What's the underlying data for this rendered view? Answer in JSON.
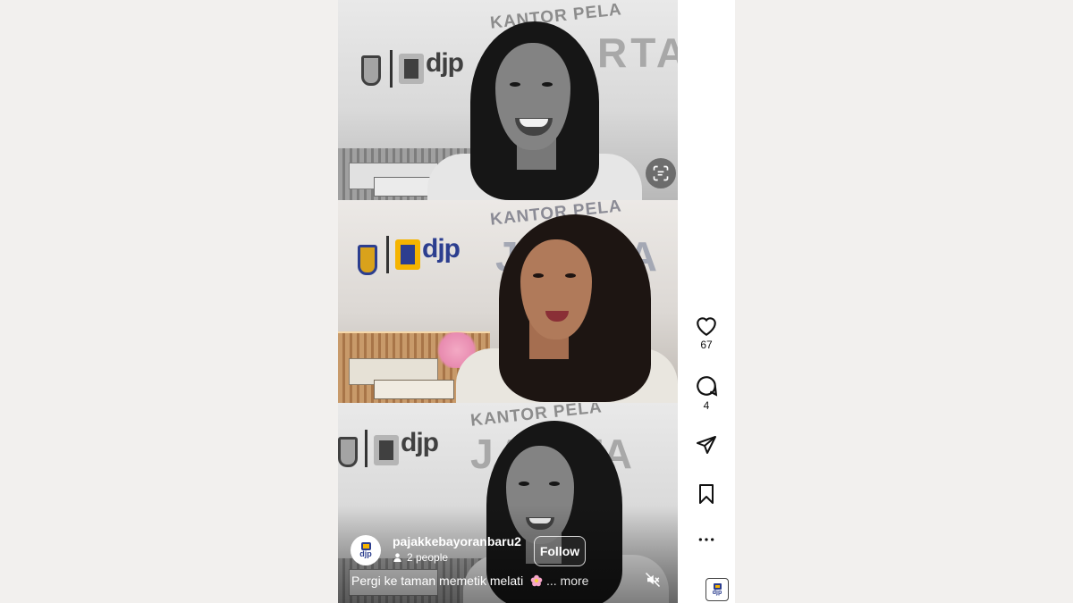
{
  "post": {
    "username": "pajakkebayoranbaru2",
    "people_count": "2 people",
    "follow_label": "Follow",
    "caption": "Pergi ke taman memetik melati",
    "more_label": "... more",
    "avatar_text": "djp"
  },
  "video": {
    "sign_logo": "djp",
    "sign_heading": "KANTOR PELA",
    "sign_letters": "RTA",
    "sign_letters_2": "JA   RTA"
  },
  "actions": {
    "likes": "67",
    "comments": "4",
    "profile_text": "djp"
  },
  "icons": {
    "like": "heart-icon",
    "comment": "comment-icon",
    "share": "send-icon",
    "save": "bookmark-icon",
    "more": "more-icon",
    "mute": "muted-speaker-icon",
    "lens": "visual-search-icon",
    "people": "person-icon"
  },
  "colors": {
    "brand_blue": "#2c3e8f",
    "brand_yellow": "#f5b400",
    "page_background": "#f2f0ee"
  }
}
